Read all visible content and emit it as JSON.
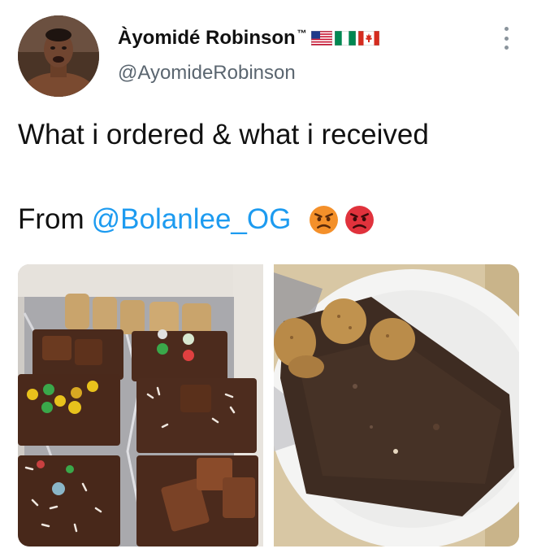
{
  "tweet": {
    "author": {
      "display_name": "Àyomidé Robinson",
      "tm": "™",
      "handle": "@AyomideRobinson",
      "flags": [
        "us-flag",
        "nigeria-flag",
        "canada-flag"
      ]
    },
    "text_line1": "What i ordered & what i received",
    "text_line2_prefix": "From",
    "mention": "@Bolanlee_OG",
    "emojis": [
      "angry-face-emoji",
      "red-angry-face-emoji"
    ],
    "photos": [
      {
        "name": "photo-ordered",
        "description_icon": "brownies-photo"
      },
      {
        "name": "photo-received",
        "description_icon": "brownie-plate-photo"
      }
    ]
  },
  "colors": {
    "mention": "#1d9bf0",
    "handle": "#5b6670",
    "text": "#111111"
  }
}
